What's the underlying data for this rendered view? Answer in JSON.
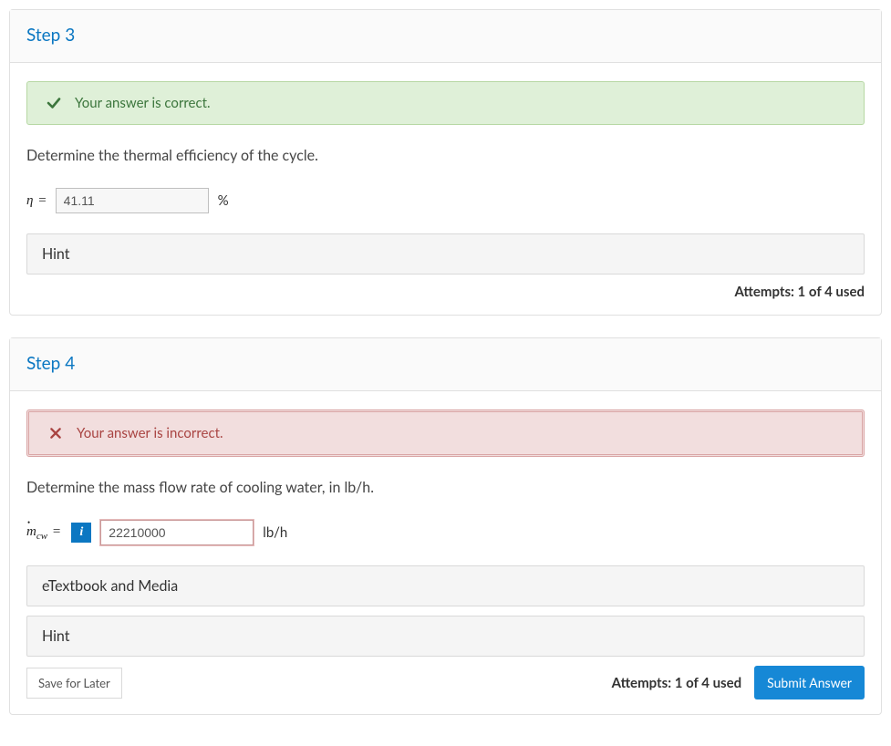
{
  "step3": {
    "title": "Step 3",
    "feedback": "Your answer is correct.",
    "prompt": "Determine the thermal efficiency of the cycle.",
    "var_prefix": "η",
    "value": "41.11",
    "unit": "%",
    "hint_label": "Hint",
    "attempts": "Attempts: 1 of 4 used"
  },
  "step4": {
    "title": "Step 4",
    "feedback": "Your answer is incorrect.",
    "prompt": "Determine the mass flow rate of cooling water, in lb/h.",
    "info_badge": "i",
    "value": "22210000",
    "unit": "lb/h",
    "etextbook_label": "eTextbook and Media",
    "hint_label": "Hint",
    "save_label": "Save for Later",
    "attempts": "Attempts: 1 of 4 used",
    "submit_label": "Submit Answer"
  }
}
